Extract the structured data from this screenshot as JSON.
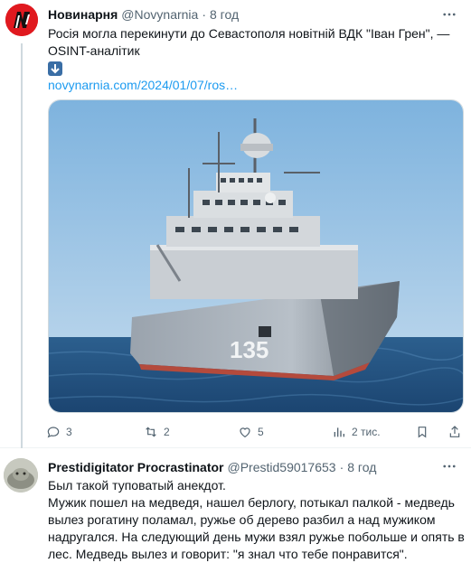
{
  "tweet1": {
    "author_name": "Новинарня",
    "author_handle": "@Novynarnia",
    "separator": "·",
    "time": "8 год",
    "text_line1": "Росія могла перекинути до Севастополя новітній ВДК \"Іван Грен\", —",
    "text_line2": "OSINT-аналітик",
    "link": "novynarnia.com/2024/01/07/ros…",
    "stats": {
      "replies": "3",
      "reposts": "2",
      "likes": "5",
      "views": "2 тис."
    },
    "ship_hull_number": "135"
  },
  "tweet2": {
    "author_name": "Prestidigitator Procrastinator",
    "author_handle": "@Prestid59017653",
    "separator": "·",
    "time": "8 год",
    "text_lines": [
      "Был такой туповатый анекдот.",
      "Мужик пошел на медведя, нашел берлогу, потыкал палкой - медведь",
      "вылез рогатину поламал, ружье об дерево разбил а над мужиком",
      "надругался. На следующий день мужи взял ружье побольше и опять в",
      "лес. Медведь вылез и говорит: \"я знал что тебе понравится\"."
    ]
  },
  "icons": {
    "reply": "reply-icon",
    "repost": "repost-icon",
    "like": "heart-icon",
    "views": "views-icon",
    "bookmark": "bookmark-icon",
    "share": "share-icon",
    "more": "more-icon"
  },
  "colors": {
    "link": "#1d9bf0",
    "secondary_text": "#536471",
    "brand_red": "#e0191f"
  }
}
